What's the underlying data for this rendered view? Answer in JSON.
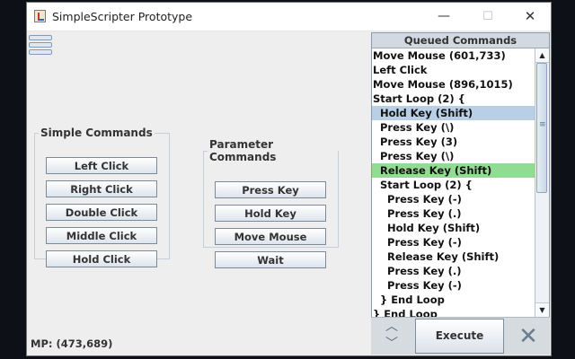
{
  "window": {
    "title": "SimpleScripter Prototype",
    "controls": {
      "minimize": "—",
      "maximize": "☐",
      "close": "✕"
    }
  },
  "simple_commands": {
    "title": "Simple Commands",
    "buttons": [
      "Left Click",
      "Right Click",
      "Double Click",
      "Middle Click",
      "Hold Click"
    ]
  },
  "parameter_commands": {
    "title": "Parameter Commands",
    "buttons": [
      "Press Key",
      "Hold Key",
      "Move Mouse",
      "Wait"
    ]
  },
  "status": {
    "mouse_position": "MP: (473,689)"
  },
  "queue": {
    "header": "Queued Commands",
    "selected_color": "#b8cfe5",
    "executing_color": "#92db92",
    "items": [
      "Move Mouse (601,733)",
      "Left Click",
      "Move Mouse (896,1015)",
      "Start Loop (2) {",
      "  Hold Key (Shift)",
      "  Press Key (\\)",
      "  Press Key (3)",
      "  Press Key (\\)",
      "  Release Key (Shift)",
      "  Start Loop (2) {",
      "    Press Key (-)",
      "    Press Key (.)",
      "    Hold Key (Shift)",
      "    Press Key (-)",
      "    Release Key (Shift)",
      "    Press Key (.)",
      "    Press Key (-)",
      "  } End Loop",
      "} End Loop"
    ]
  },
  "controls": {
    "move_up_icon": "chevron-up-icon",
    "move_down_icon": "chevron-down-icon",
    "execute_label": "Execute",
    "clear_icon": "close-icon"
  }
}
